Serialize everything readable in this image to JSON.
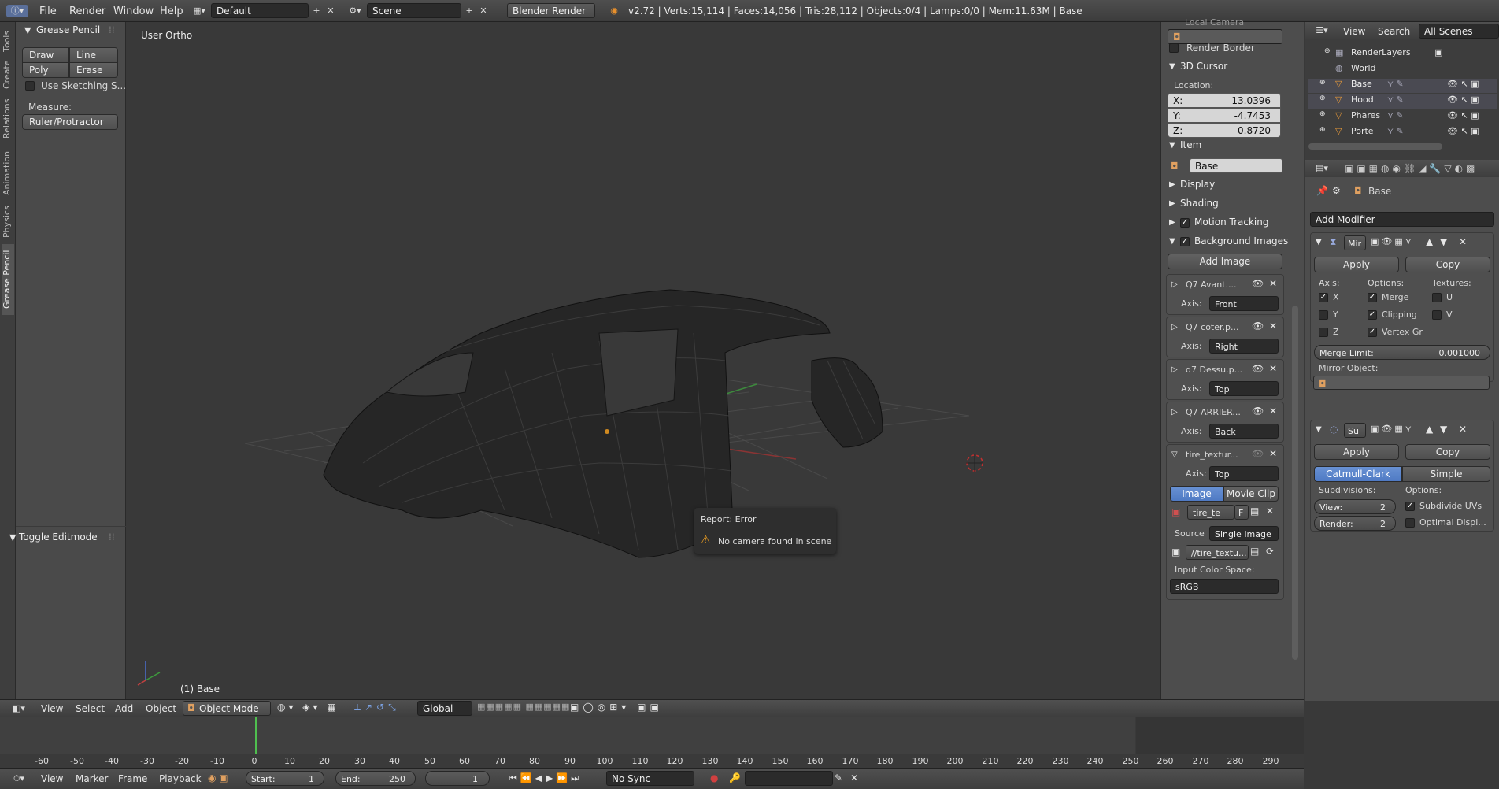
{
  "topbar": {
    "menus": [
      "File",
      "Render",
      "Window",
      "Help"
    ],
    "layout": "Default",
    "scene": "Scene",
    "engine": "Blender Render",
    "stats": "v2.72 | Verts:15,114 | Faces:14,056 | Tris:28,112 | Objects:0/4 | Lamps:0/0 | Mem:11.63M | Base"
  },
  "tool_tabs": [
    "Tools",
    "Create",
    "Relations",
    "Animation",
    "Physics",
    "Grease Pencil"
  ],
  "grease_pencil": {
    "title": "Grease Pencil",
    "draw": "Draw",
    "line": "Line",
    "poly": "Poly",
    "erase": "Erase",
    "sketching": "Use Sketching S...",
    "measure": "Measure:",
    "ruler": "Ruler/Protractor"
  },
  "toggle_editmode": "Toggle Editmode",
  "viewport": {
    "view_label": "User Ortho",
    "object_label": "(1) Base"
  },
  "report": {
    "title": "Report: Error",
    "message": "No camera found in scene"
  },
  "npanel": {
    "local_camera": "Local Camera",
    "render_border": "Render Border",
    "cursor_title": "3D Cursor",
    "location": "Location:",
    "x_label": "X:",
    "x": "13.0396",
    "y_label": "Y:",
    "y": "-4.7453",
    "z_label": "Z:",
    "z": "0.8720",
    "item_title": "Item",
    "item_name": "Base",
    "display": "Display",
    "shading": "Shading",
    "motion": "Motion Tracking",
    "bg_images": "Background Images",
    "add_image": "Add Image",
    "axis_label": "Axis:",
    "images": [
      {
        "name": "Q7 Avant....",
        "axis": "Front"
      },
      {
        "name": "Q7 coter.p...",
        "axis": "Right"
      },
      {
        "name": "q7 Dessu.p...",
        "axis": "Top"
      },
      {
        "name": "Q7 ARRIER...",
        "axis": "Back"
      },
      {
        "name": "tire_textur...",
        "axis": "Top"
      }
    ],
    "image_tab": "Image",
    "movieclip_tab": "Movie Clip",
    "tex_name": "tire_te",
    "tex_f": "F",
    "source_label": "Source",
    "source": "Single Image",
    "path": "//tire_textu...",
    "color_space_label": "Input Color Space:",
    "color_space": "sRGB"
  },
  "outliner": {
    "view": "View",
    "search": "Search",
    "scenes": "All Scenes",
    "items": [
      "RenderLayers",
      "World",
      "Base",
      "Hood",
      "Phares",
      "Porte"
    ]
  },
  "properties": {
    "object": "Base",
    "add_modifier": "Add Modifier",
    "mirror": {
      "name": "Mir",
      "apply": "Apply",
      "copy": "Copy",
      "axis": "Axis:",
      "options": "Options:",
      "textures": "Textures:",
      "x": "X",
      "y": "Y",
      "z": "Z",
      "merge": "Merge",
      "clipping": "Clipping",
      "vertex": "Vertex Gr",
      "u": "U",
      "v": "V",
      "merge_limit_label": "Merge Limit:",
      "merge_limit": "0.001000",
      "mirror_object": "Mirror Object:"
    },
    "subsurf": {
      "name": "Su",
      "apply": "Apply",
      "copy": "Copy",
      "catmull": "Catmull-Clark",
      "simple": "Simple",
      "subdivisions": "Subdivisions:",
      "options": "Options:",
      "view_label": "View:",
      "view": "2",
      "render_label": "Render:",
      "render": "2",
      "subdivide_uvs": "Subdivide UVs",
      "optimal": "Optimal Displ..."
    }
  },
  "header3d": {
    "view": "View",
    "select": "Select",
    "add": "Add",
    "object": "Object",
    "mode": "Object Mode",
    "orientation": "Global"
  },
  "timeline": {
    "ticks": [
      "-60",
      "-50",
      "-40",
      "-30",
      "-20",
      "-10",
      "0",
      "10",
      "20",
      "30",
      "40",
      "50",
      "60",
      "70",
      "80",
      "90",
      "100",
      "110",
      "120",
      "130",
      "140",
      "150",
      "160",
      "170",
      "180",
      "190",
      "200",
      "210",
      "220",
      "230",
      "240",
      "250",
      "260",
      "270",
      "280",
      "290"
    ],
    "view": "View",
    "marker": "Marker",
    "frame": "Frame",
    "playback": "Playback",
    "start_label": "Start:",
    "start": "1",
    "end_label": "End:",
    "end": "250",
    "current": "1",
    "sync": "No Sync"
  }
}
